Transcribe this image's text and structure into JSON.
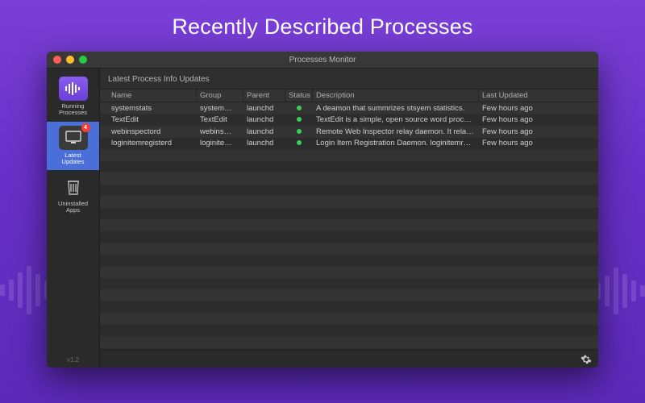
{
  "hero": {
    "title": "Recently Described Processes"
  },
  "window": {
    "title": "Processes Monitor"
  },
  "sidebar": {
    "items": [
      {
        "label": "Running\nProcesses"
      },
      {
        "label": "Latest\nUpdates",
        "badge": "4"
      },
      {
        "label": "Uninstalled\nApps"
      }
    ],
    "version": "v1.2"
  },
  "panel": {
    "title": "Latest Process Info Updates"
  },
  "columns": {
    "name": "Name",
    "group": "Group",
    "parent": "Parent",
    "status": "Status",
    "description": "Description",
    "lastUpdated": "Last Updated"
  },
  "rows": [
    {
      "name": "systemstats",
      "group": "system…",
      "parent": "launchd",
      "status": "green",
      "description": "A deamon that summrizes stsyem statistics.",
      "lastUpdated": "Few hours ago"
    },
    {
      "name": "TextEdit",
      "group": "TextEdit",
      "parent": "launchd",
      "status": "green",
      "description": "TextEdit is a simple, open source word proc…",
      "lastUpdated": "Few hours ago"
    },
    {
      "name": "webinspectord",
      "group": "webins…",
      "parent": "launchd",
      "status": "green",
      "description": "Remote Web Inspector relay daemon. It rela…",
      "lastUpdated": "Few hours ago"
    },
    {
      "name": "loginitemregisterd",
      "group": "loginite…",
      "parent": "launchd",
      "status": "green",
      "description": "Login Item Registration Daemon. loginitemr…",
      "lastUpdated": "Few hours ago"
    }
  ],
  "emptyRowCount": 20
}
